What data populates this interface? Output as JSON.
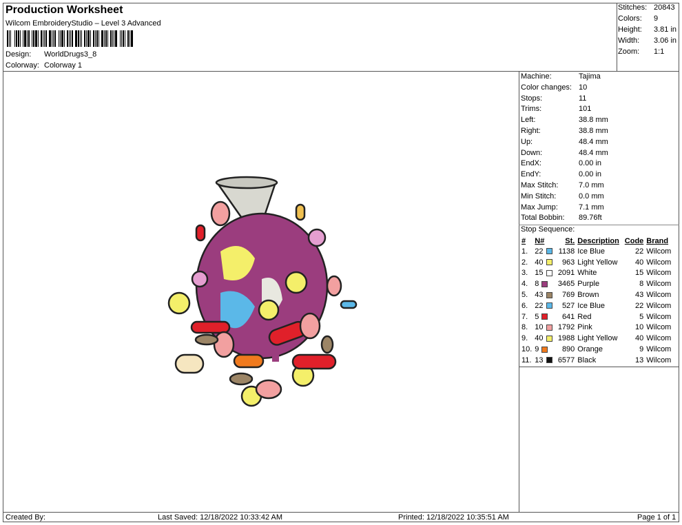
{
  "header": {
    "title": "Production Worksheet",
    "software": "Wilcom EmbroideryStudio – Level 3 Advanced",
    "design_label": "Design:",
    "design_value": "WorldDrugs3_8",
    "colorway_label": "Colorway:",
    "colorway_value": "Colorway 1"
  },
  "summary": [
    {
      "label": "Stitches:",
      "value": "20843"
    },
    {
      "label": "Colors:",
      "value": "9"
    },
    {
      "label": "Height:",
      "value": "3.81 in"
    },
    {
      "label": "Width:",
      "value": "3.06 in"
    },
    {
      "label": "Zoom:",
      "value": "1:1"
    }
  ],
  "machine_info": [
    {
      "label": "Machine:",
      "value": "Tajima"
    },
    {
      "label": "Color changes:",
      "value": "10"
    },
    {
      "label": "Stops:",
      "value": "11"
    },
    {
      "label": "Trims:",
      "value": "101"
    },
    {
      "label": "Left:",
      "value": "38.8 mm"
    },
    {
      "label": "Right:",
      "value": "38.8 mm"
    },
    {
      "label": "Up:",
      "value": "48.4 mm"
    },
    {
      "label": "Down:",
      "value": "48.4 mm"
    },
    {
      "label": "EndX:",
      "value": "0.00 in"
    },
    {
      "label": "EndY:",
      "value": "0.00 in"
    },
    {
      "label": "Max Stitch:",
      "value": "7.0 mm"
    },
    {
      "label": "Min Stitch:",
      "value": "0.0 mm"
    },
    {
      "label": "Max Jump:",
      "value": "7.1 mm"
    },
    {
      "label": "Total Bobbin:",
      "value": "89.76ft"
    }
  ],
  "stop_sequence": {
    "title": "Stop Sequence:",
    "columns": [
      "#",
      "N#",
      "St.",
      "Description",
      "Code",
      "Brand"
    ],
    "rows": [
      {
        "idx": "1.",
        "n": "22",
        "color": "#5bb8e8",
        "st": "1138",
        "desc": "Ice Blue",
        "code": "22",
        "brand": "Wilcom"
      },
      {
        "idx": "2.",
        "n": "40",
        "color": "#f4ef6a",
        "st": "963",
        "desc": "Light Yellow",
        "code": "40",
        "brand": "Wilcom"
      },
      {
        "idx": "3.",
        "n": "15",
        "color": "#ffffff",
        "st": "2091",
        "desc": "White",
        "code": "15",
        "brand": "Wilcom"
      },
      {
        "idx": "4.",
        "n": "8",
        "color": "#9b3d7e",
        "st": "3465",
        "desc": "Purple",
        "code": "8",
        "brand": "Wilcom"
      },
      {
        "idx": "5.",
        "n": "43",
        "color": "#9c8566",
        "st": "769",
        "desc": "Brown",
        "code": "43",
        "brand": "Wilcom"
      },
      {
        "idx": "6.",
        "n": "22",
        "color": "#5bb8e8",
        "st": "527",
        "desc": "Ice Blue",
        "code": "22",
        "brand": "Wilcom"
      },
      {
        "idx": "7.",
        "n": "5",
        "color": "#e0202a",
        "st": "641",
        "desc": "Red",
        "code": "5",
        "brand": "Wilcom"
      },
      {
        "idx": "8.",
        "n": "10",
        "color": "#f2a0a0",
        "st": "1792",
        "desc": "Pink",
        "code": "10",
        "brand": "Wilcom"
      },
      {
        "idx": "9.",
        "n": "40",
        "color": "#f4ef6a",
        "st": "1988",
        "desc": "Light Yellow",
        "code": "40",
        "brand": "Wilcom"
      },
      {
        "idx": "10.",
        "n": "9",
        "color": "#f07a1e",
        "st": "890",
        "desc": "Orange",
        "code": "9",
        "brand": "Wilcom"
      },
      {
        "idx": "11.",
        "n": "13",
        "color": "#111111",
        "st": "6577",
        "desc": "Black",
        "code": "13",
        "brand": "Wilcom"
      }
    ]
  },
  "footer": {
    "created_by": "Created By:",
    "last_saved": "Last Saved: 12/18/2022 10:33:42 AM",
    "printed": "Printed: 12/18/2022 10:35:51 AM",
    "page": "Page 1 of 1"
  }
}
